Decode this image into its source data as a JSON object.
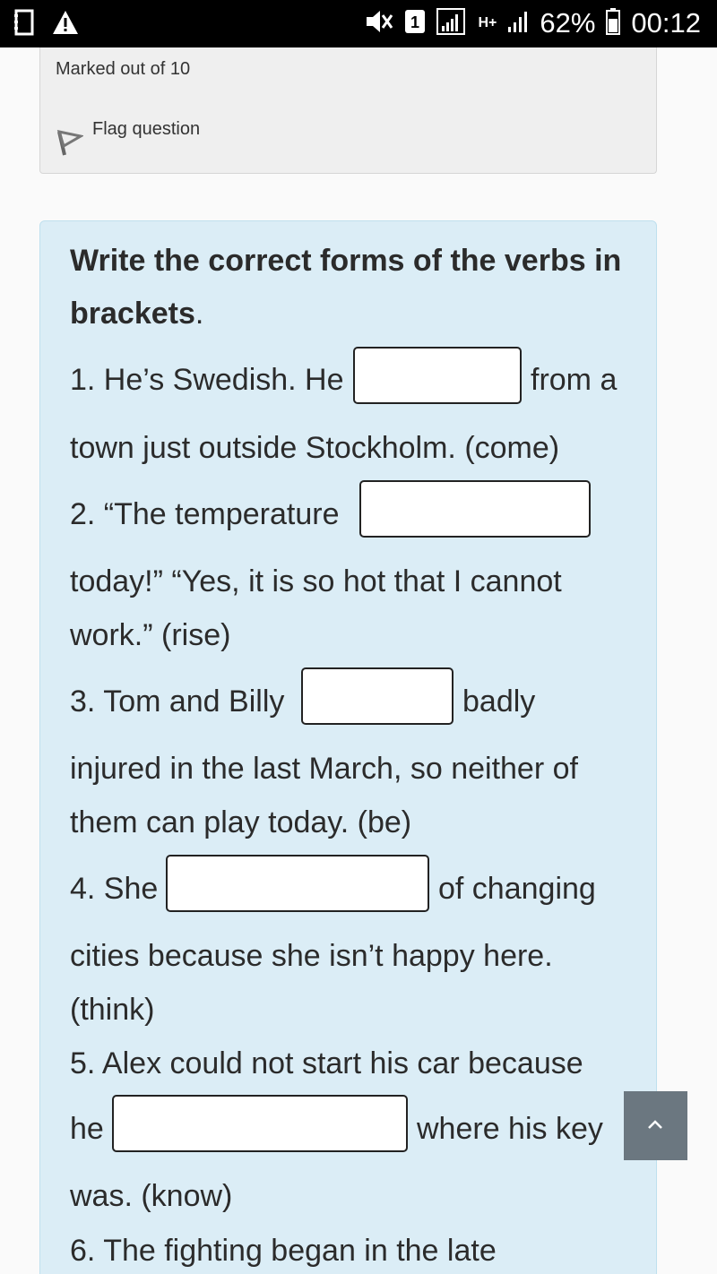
{
  "status_bar": {
    "battery": "62%",
    "time": "00:12",
    "network": "H+",
    "sim_slot": "1"
  },
  "question_info": {
    "marked": "Marked out of 10",
    "flag_label": "Flag question"
  },
  "question": {
    "title": "Write the correct forms of the verbs in",
    "title_bold_2": "brackets",
    "title_period": ".",
    "items": [
      {
        "before": "1. He’s Swedish. He",
        "after": "from a",
        "line2": "town just outside Stockholm. (come)",
        "line3": "",
        "answer": ""
      },
      {
        "before": "2. “The temperature",
        "after": "",
        "line2": "today!” “Yes, it is so hot that I cannot",
        "line3": "work.” (rise)",
        "answer": ""
      },
      {
        "before": "3. Tom and Billy",
        "after": "badly",
        "line2": "injured in the last March, so neither of",
        "line3": "them can play today. (be)",
        "answer": ""
      },
      {
        "before": "4. She",
        "after": "of changing",
        "line2": "cities because she isn’t happy here.",
        "line3": "(think)",
        "answer": ""
      },
      {
        "before": "5. Alex could not start his car because",
        "after": "",
        "line2": "he",
        "line2_after": "where his key",
        "line3": "was. (know)",
        "answer": ""
      },
      {
        "before": "6. The fighting began in the late",
        "after": "",
        "line2": "",
        "line3": "",
        "answer": ""
      }
    ]
  },
  "icons": [
    "notes-icon",
    "warning-icon",
    "mute-icon",
    "sim-icon",
    "signal-icon",
    "battery-icon",
    "flag-icon",
    "chevron-up-icon"
  ]
}
